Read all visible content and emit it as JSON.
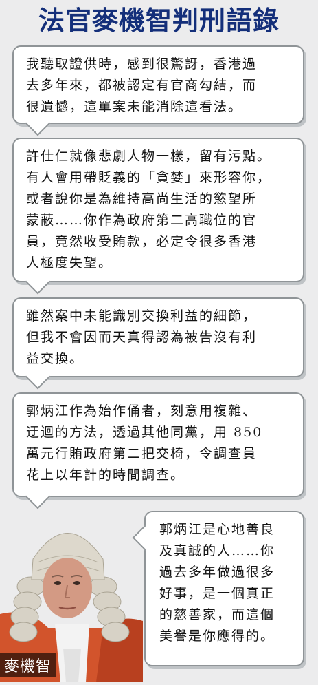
{
  "title": "法官麥機智判刑語錄",
  "quotes": [
    "我聽取證供時，感到很驚訝，香港過\n去多年來，都被認定有官商勾結，而\n很遺憾，這單案未能消除這看法。",
    "許仕仁就像悲劇人物一樣，留有污點。\n有人會用帶貶義的「貪婪」來形容你，\n或者說你是為維持高尚生活的慾望所\n蒙蔽……你作為政府第二高職位的官\n員，竟然收受賄款，必定令很多香港\n人極度失望。",
    "雖然案中未能識別交換利益的細節，\n但我不會因而天真得認為被告沒有利\n益交換。",
    "郭炳江作為始作俑者，刻意用複雜、\n迂迴的方法，透過其他同黨，用 850\n萬元行賄政府第二把交椅，令調查員\n花上以年計的時間調查。",
    "郭炳江是心地善良\n及真誠的人……你\n過去多年做過很多\n好事，是一個真正\n的慈善家，而這個\n美譽是你應得的。"
  ],
  "portrait_caption": "麥機智",
  "colors": {
    "title": "#142f7a",
    "background": "#ececed",
    "robe": "#d2542c"
  }
}
